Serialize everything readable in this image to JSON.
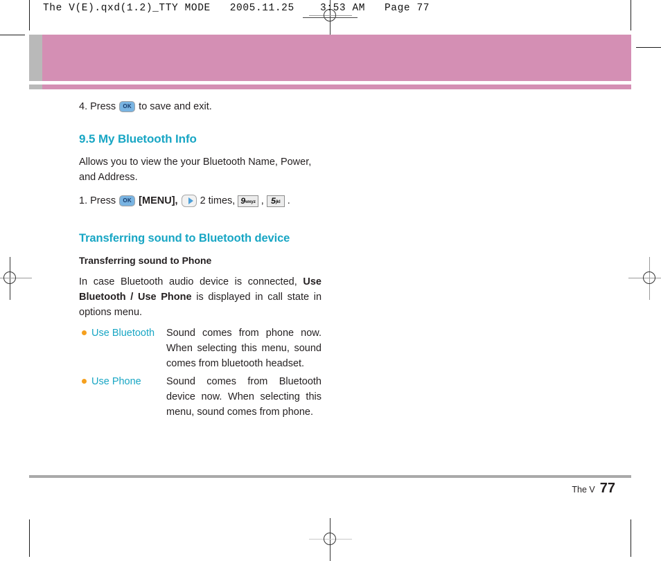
{
  "print_slug": {
    "text": "The V(E).qxd(1.2)_TTY MODE   2005.11.25    3:53 AM   Page 77"
  },
  "banner": {
    "color": "#d48fb4",
    "tab_color": "#b9b9b9"
  },
  "content": {
    "step4": {
      "number": "4.",
      "press_label": "Press",
      "key_ok": "OK",
      "tail": "to save and exit."
    },
    "section": {
      "title": "9.5 My Bluetooth Info",
      "intro": "Allows you to view the your Bluetooth Name, Power, and Address."
    },
    "step1": {
      "number": "1.",
      "press_label": "Press",
      "key_ok": "OK",
      "menu_label": "[MENU],",
      "times_label": "2 times,",
      "key9_digit": "9",
      "key9_letters": "wxyz",
      "comma": ",",
      "key5_digit": "5",
      "key5_letters": "jkl",
      "period": "."
    },
    "transfer": {
      "heading": "Transferring sound to Bluetooth device",
      "subheading": "Transferring sound to Phone",
      "paragraph_part1": "In case Bluetooth audio device is connected, ",
      "paragraph_bold": "Use Bluetooth / Use Phone",
      "paragraph_part2": " is displayed in call state in options menu.",
      "options": [
        {
          "label": "Use Bluetooth",
          "desc": "Sound comes from phone now. When selecting this menu, sound comes from bluetooth headset."
        },
        {
          "label": "Use Phone",
          "desc": "Sound comes from Bluetooth device now. When selecting this menu, sound comes from phone."
        }
      ]
    }
  },
  "footer": {
    "book": "The V",
    "page_number": "77"
  }
}
